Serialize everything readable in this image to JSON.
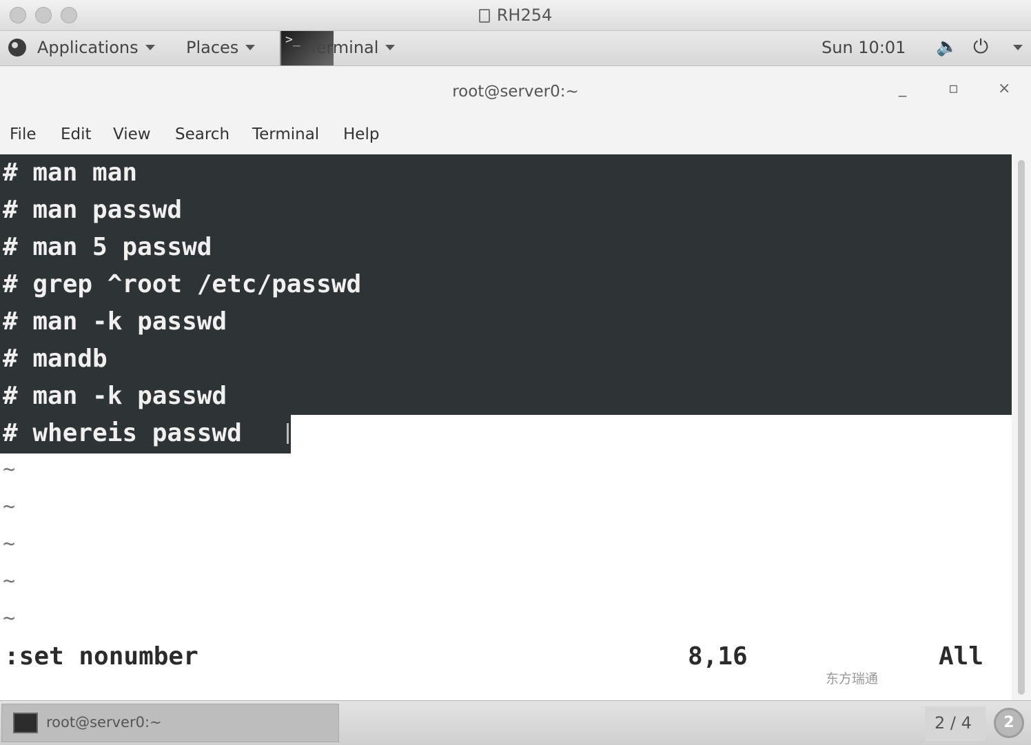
{
  "outer_window": {
    "title": "RH254"
  },
  "top_panel": {
    "applications": "Applications",
    "places": "Places",
    "terminal": "Terminal",
    "clock": "Sun 10:01"
  },
  "terminal_window": {
    "title": "root@server0:~",
    "minimize": "_",
    "maximize": "▫",
    "close": "×",
    "menu": [
      "File",
      "Edit",
      "View",
      "Search",
      "Terminal",
      "Help"
    ]
  },
  "vim": {
    "lines": [
      "# man man",
      "# man passwd",
      "# man 5 passwd",
      "# grep ^root /etc/passwd",
      "# man -k passwd",
      "# mandb",
      "# man -k passwd",
      "# whereis passwd"
    ],
    "tildes": [
      "~",
      "~",
      "~",
      "~",
      "~"
    ],
    "command": ":set nonumber",
    "position": "8,16",
    "scroll": "All"
  },
  "watermark": "东方瑞通",
  "bottom_panel": {
    "task_label": "root@server0:~",
    "workspace": "2 / 4",
    "notification_count": "2"
  }
}
